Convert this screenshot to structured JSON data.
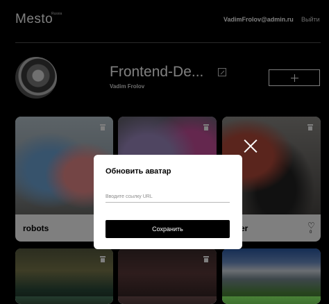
{
  "header": {
    "logo": "Mesto",
    "logo_sup": "Russia",
    "email": "VadimFrolov@admin.ru",
    "logout": "Выйти"
  },
  "profile": {
    "name": "Frontend-De...",
    "about": "Vadim Frolov"
  },
  "cards": [
    {
      "title": "robots",
      "likes": ""
    },
    {
      "title": "",
      "likes": ""
    },
    {
      "title": "ader",
      "likes": "0"
    },
    {
      "title": "",
      "likes": ""
    },
    {
      "title": "",
      "likes": ""
    },
    {
      "title": "",
      "likes": ""
    }
  ],
  "popup": {
    "title": "Обновить аватар",
    "input_placeholder": "Вводите ссылку URL",
    "submit_label": "Сохранить"
  }
}
